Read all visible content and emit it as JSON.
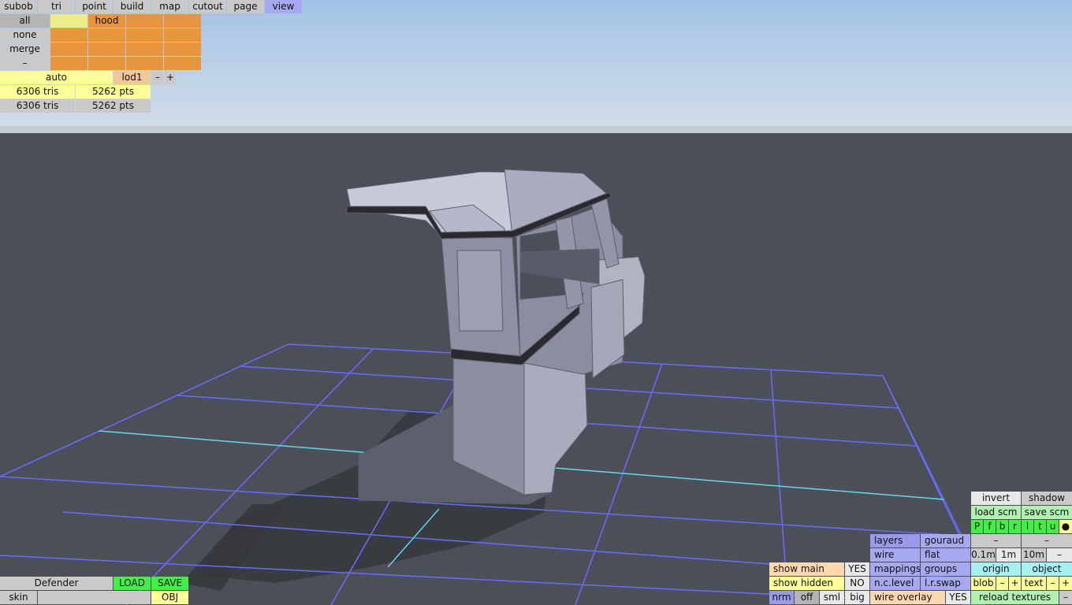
{
  "menu": {
    "items": [
      "subob",
      "tri",
      "point",
      "build",
      "map",
      "cutout",
      "page",
      "view"
    ],
    "active": "view"
  },
  "selection": {
    "row_labels": [
      "all",
      "none",
      "merge",
      "–"
    ],
    "hood": "hood"
  },
  "lod": {
    "mode": "auto",
    "level": "lod1",
    "minus": "–",
    "plus": "+"
  },
  "stats": [
    {
      "tris": "6306 tris",
      "pts": "5262 pts"
    },
    {
      "tris": "6306 tris",
      "pts": "5262 pts"
    }
  ],
  "file": {
    "name": "Defender",
    "load": "LOAD",
    "save": "SAVE",
    "skin": "skin",
    "obj": "OBJ"
  },
  "show": {
    "main": "show main",
    "main_value": "YES",
    "hidden": "show hidden",
    "hidden_value": "NO"
  },
  "normals": {
    "nrm": "nrm",
    "off": "off",
    "sml": "sml",
    "big": "big"
  },
  "display": {
    "layers": "layers",
    "gouraud": "gouraud",
    "wire": "wire",
    "flat": "flat",
    "mappings": "mappings",
    "groups": "groups",
    "nc_level": "n.c.level",
    "lr_swap": "l.r.swap",
    "wire_overlay": "wire overlay",
    "wire_overlay_value": "YES"
  },
  "right_panel": {
    "invert": "invert",
    "shadow": "shadow",
    "load_scm": "load scm",
    "save_scm": "save scm",
    "views": [
      "P",
      "f",
      "b",
      "r",
      "l",
      "t",
      "u"
    ],
    "dot": "●",
    "dash1": "–",
    "dash2": "–",
    "grid": [
      "0.1m",
      "1m",
      "10m"
    ],
    "grid_minus": "–",
    "origin": "origin",
    "object": "object",
    "blob": "blob",
    "blob_minus": "–",
    "blob_plus": "+",
    "text": "text",
    "text_minus": "–",
    "text_plus": "+",
    "reload": "reload textures",
    "reload_minus": "–"
  },
  "colors": {
    "sky_top": "#a2c2e6",
    "sky_bottom": "#d4dee8",
    "ground": "#4c4f57",
    "grid": "#6a6aff",
    "axis": "#5fd8e8",
    "body": "#9a9eae"
  }
}
